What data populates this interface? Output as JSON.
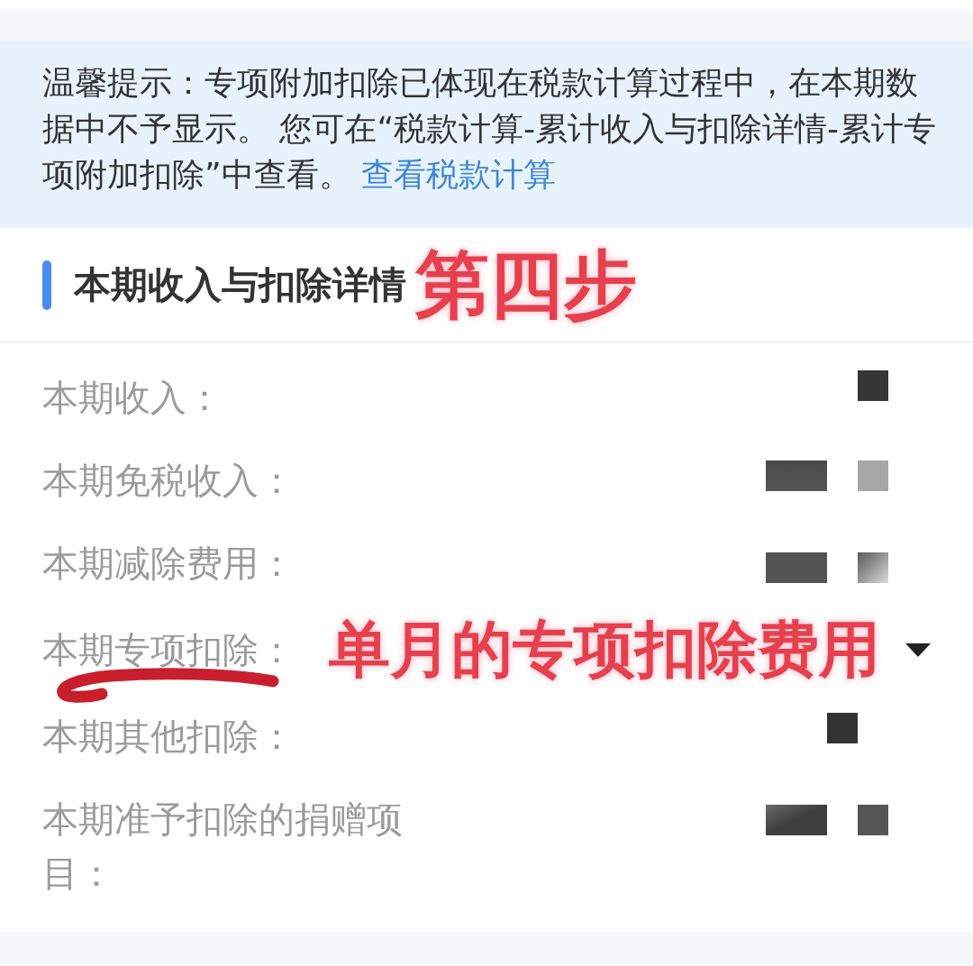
{
  "notice": {
    "text": "温馨提示：专项附加扣除已体现在税款计算过程中，在本期数据中不予显示。 您可在“税款计算-累计收入与扣除详情-累计专项附加扣除”中查看。 ",
    "link": "查看税款计算"
  },
  "section": {
    "title": "本期收入与扣除详情",
    "annotation": "第四步"
  },
  "rows": [
    {
      "label": "本期收入：",
      "kind": "end",
      "underlined": false,
      "expandable": false
    },
    {
      "label": "本期免税收入：",
      "kind": "pair-light",
      "underlined": false,
      "expandable": false
    },
    {
      "label": "本期减除费用：",
      "kind": "pair-fade",
      "underlined": false,
      "expandable": false
    },
    {
      "label": "本期专项扣除：",
      "kind": "annotated",
      "annotation": "单月的专项扣除费用",
      "underlined": true,
      "expandable": true
    },
    {
      "label": "本期其他扣除：",
      "kind": "middle",
      "underlined": false,
      "expandable": false
    },
    {
      "label": "本期准予扣除的捐赠项目：",
      "kind": "pair-dark",
      "underlined": false,
      "expandable": false
    }
  ]
}
